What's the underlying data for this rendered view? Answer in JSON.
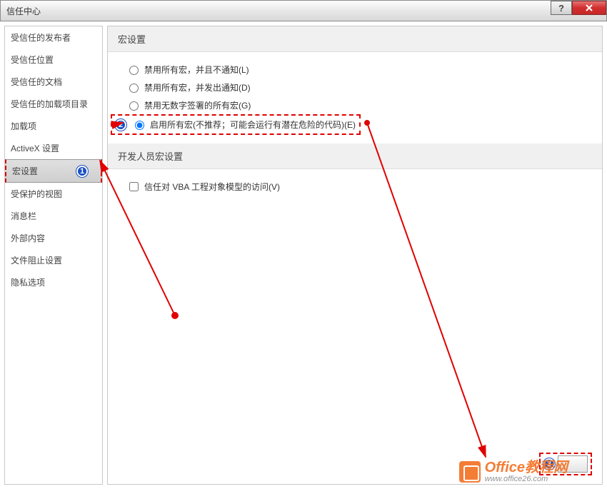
{
  "window": {
    "title": "信任中心"
  },
  "sidebar": {
    "items": [
      {
        "label": "受信任的发布者"
      },
      {
        "label": "受信任位置"
      },
      {
        "label": "受信任的文档"
      },
      {
        "label": "受信任的加载项目录"
      },
      {
        "label": "加载项"
      },
      {
        "label": "ActiveX 设置"
      },
      {
        "label": "宏设置"
      },
      {
        "label": "受保护的视图"
      },
      {
        "label": "消息栏"
      },
      {
        "label": "外部内容"
      },
      {
        "label": "文件阻止设置"
      },
      {
        "label": "隐私选项"
      }
    ],
    "selected_index": 6
  },
  "main": {
    "section1_title": "宏设置",
    "radios": [
      {
        "label": "禁用所有宏，并且不通知(L)"
      },
      {
        "label": "禁用所有宏，并发出通知(D)"
      },
      {
        "label": "禁用无数字签署的所有宏(G)"
      },
      {
        "label": "启用所有宏(不推荐；可能会运行有潜在危险的代码)(E)"
      }
    ],
    "selected_radio": 3,
    "section2_title": "开发人员宏设置",
    "checkbox_label": "信任对 VBA 工程对象模型的访问(V)"
  },
  "annotations": {
    "badge1": "1",
    "badge2": "2",
    "badge3": "3"
  },
  "watermark": {
    "title": "Office教程网",
    "url": "www.office26.com"
  }
}
